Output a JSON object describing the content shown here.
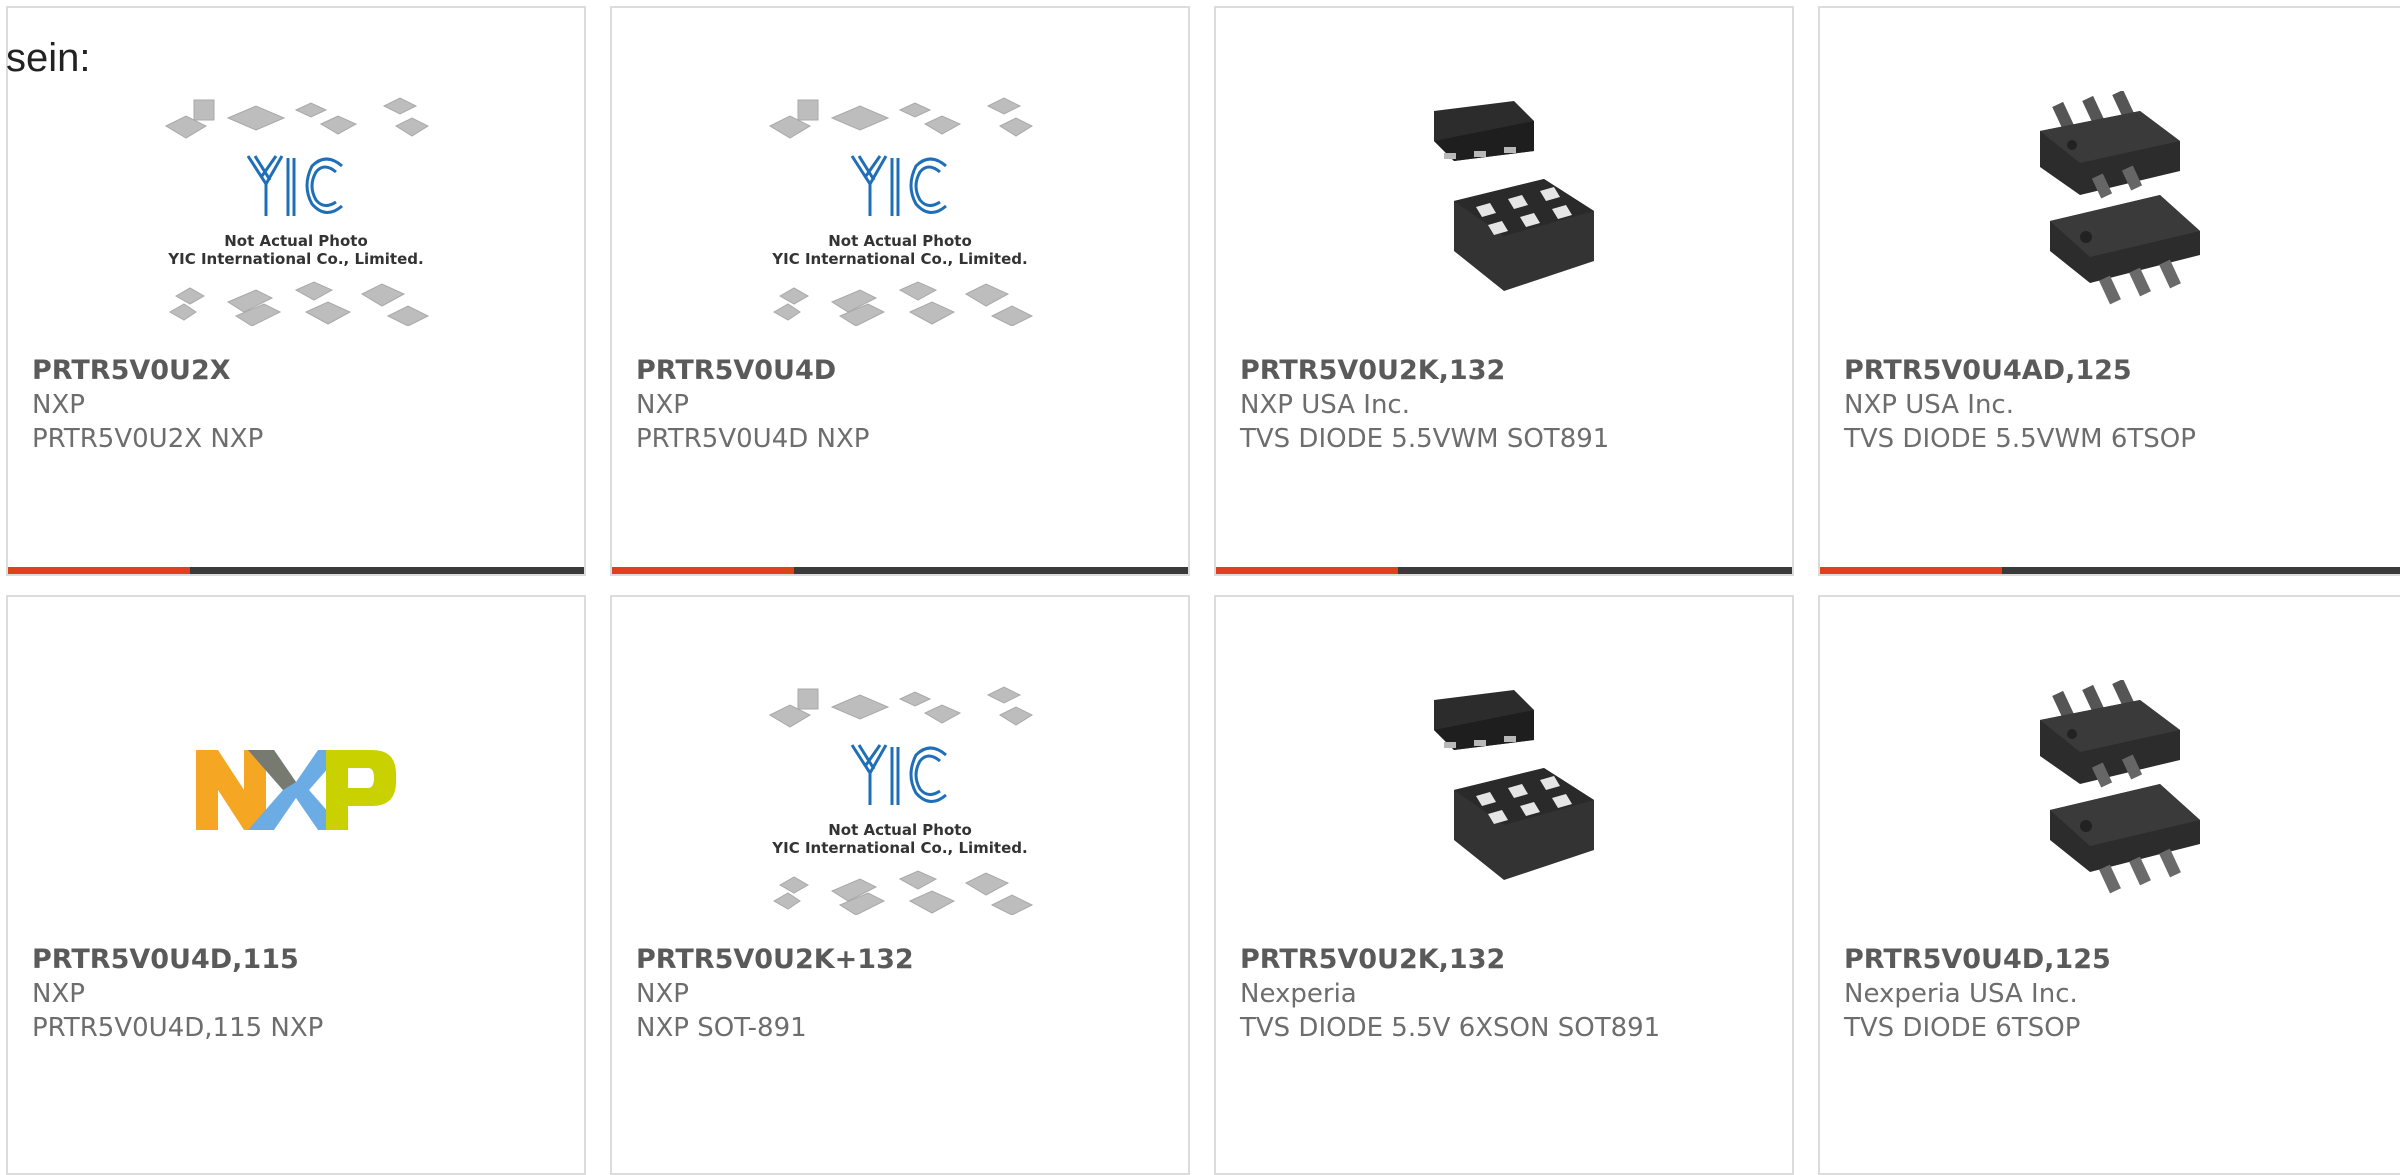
{
  "intro_text": "sein:",
  "placeholder": {
    "line1": "Not Actual Photo",
    "line2": "YIC International Co., Limited."
  },
  "products": [
    {
      "part": "PRTR5V0U2X",
      "maker": "NXP",
      "desc": "PRTR5V0U2X NXP",
      "image": "yic-placeholder"
    },
    {
      "part": "PRTR5V0U4D",
      "maker": "NXP",
      "desc": "PRTR5V0U4D NXP",
      "image": "yic-placeholder"
    },
    {
      "part": "PRTR5V0U2K,132",
      "maker": "NXP USA Inc.",
      "desc": "TVS DIODE 5.5VWM SOT891",
      "image": "sot891-package"
    },
    {
      "part": "PRTR5V0U4AD,125",
      "maker": "NXP USA Inc.",
      "desc": "TVS DIODE 5.5VWM 6TSOP",
      "image": "tsop6-package"
    },
    {
      "part": "PRTR5V0U4D,115",
      "maker": "NXP",
      "desc": "PRTR5V0U4D,115 NXP",
      "image": "nxp-logo"
    },
    {
      "part": "PRTR5V0U2K+132",
      "maker": "NXP",
      "desc": "NXP SOT-891",
      "image": "yic-placeholder"
    },
    {
      "part": "PRTR5V0U2K,132",
      "maker": "Nexperia",
      "desc": "TVS DIODE 5.5V 6XSON SOT891",
      "image": "sot891-package"
    },
    {
      "part": "PRTR5V0U4D,125",
      "maker": "Nexperia USA Inc.",
      "desc": "TVS DIODE 6TSOP",
      "image": "tsop6-package"
    }
  ],
  "colors": {
    "accent": "#e0401c",
    "bar": "#3a3a3a",
    "border": "#dcdcdc",
    "part_number": "#5a5a5a",
    "text": "#6d6d6d"
  }
}
